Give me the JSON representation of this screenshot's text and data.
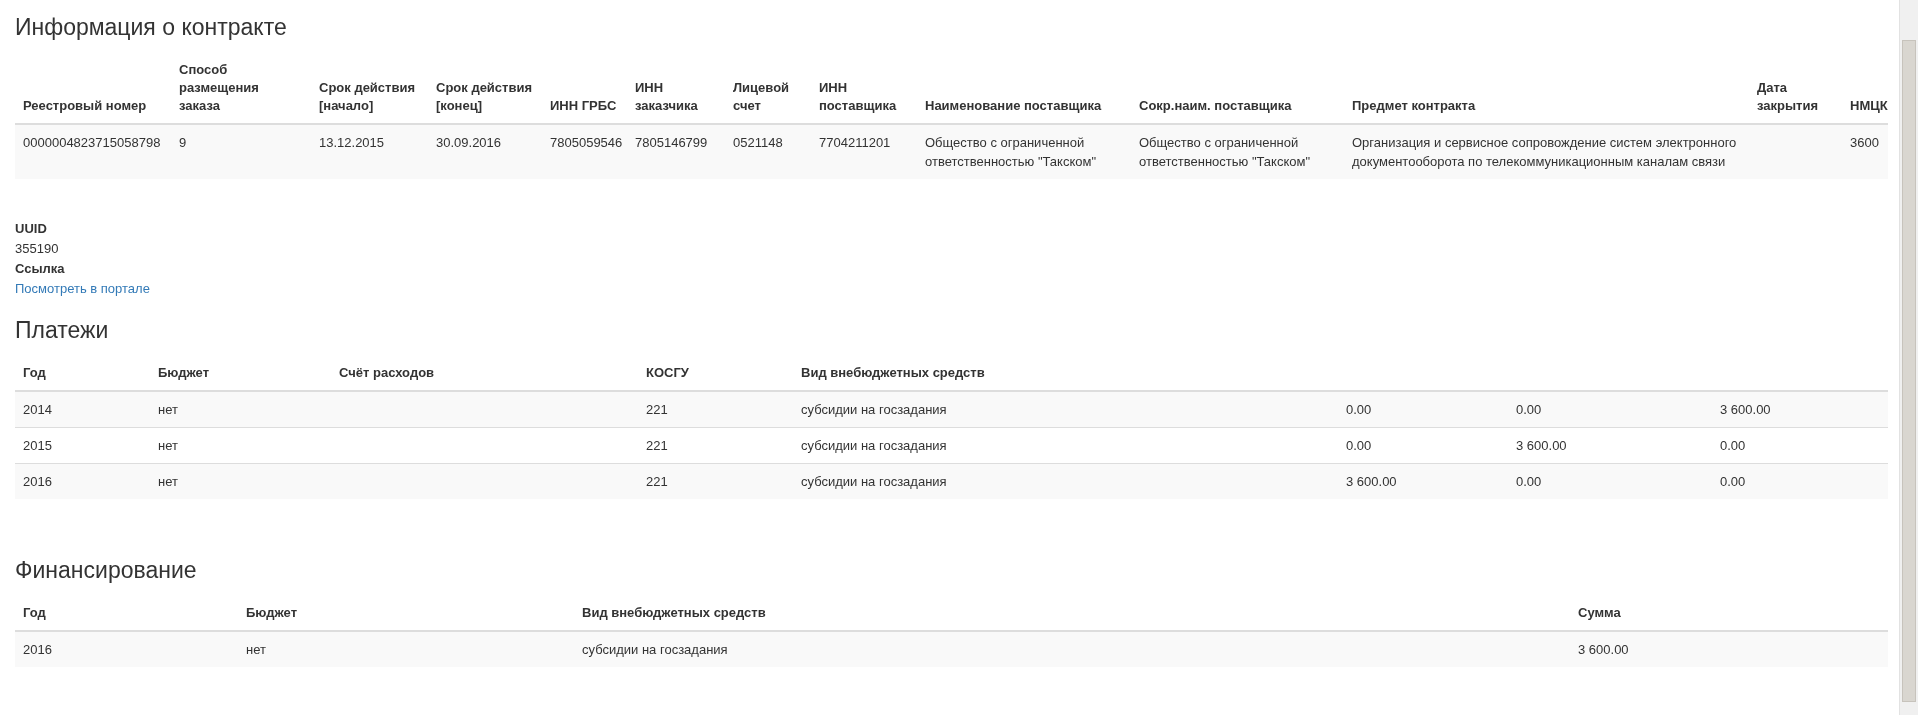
{
  "contract": {
    "title": "Информация о контракте",
    "columns": [
      "Реестровый номер",
      "Способ размещения заказа",
      "Срок действия [начало]",
      "Срок действия [конец]",
      "ИНН ГРБС",
      "ИНН заказчика",
      "Лицевой счет",
      "ИНН поставщика",
      "Наименование поставщика",
      "Сокр.наим. поставщика",
      "Предмет контракта",
      "Дата закрытия",
      "НМЦК"
    ],
    "rows": [
      [
        "0000004823715058798",
        "9",
        "13.12.2015",
        "30.09.2016",
        "7805059546",
        "7805146799",
        "0521148",
        "7704211201",
        "Общество с ограниченной ответственностью \"Такском\"",
        "Общество с ограниченной ответственностью \"Такском\"",
        "Организация и сервисное сопровождение систем электронного документооборота по телекоммуникационным каналам связи",
        "",
        "3600"
      ]
    ]
  },
  "details": [
    {
      "label": "UUID",
      "value": "355190",
      "kind": "text"
    },
    {
      "label": "Ссылка",
      "value": "Посмотреть в портале",
      "kind": "link"
    }
  ],
  "payments": {
    "title": "Платежи",
    "columns": [
      "Год",
      "Бюджет",
      "Счёт расходов",
      "КОСГУ",
      "Вид внебюджетных средств",
      "",
      "",
      ""
    ],
    "rows": [
      [
        "2014",
        "нет",
        "",
        "221",
        "субсидии на госзадания",
        "0.00",
        "0.00",
        "3 600.00"
      ],
      [
        "2015",
        "нет",
        "",
        "221",
        "субсидии на госзадания",
        "0.00",
        "3 600.00",
        "0.00"
      ],
      [
        "2016",
        "нет",
        "",
        "221",
        "субсидии на госзадания",
        "3 600.00",
        "0.00",
        "0.00"
      ]
    ]
  },
  "financing": {
    "title": "Финансирование",
    "columns": [
      "Год",
      "Бюджет",
      "Вид внебюджетных средств",
      "Сумма"
    ],
    "rows": [
      [
        "2016",
        "нет",
        "субсидии на госзадания",
        "3 600.00"
      ]
    ]
  }
}
